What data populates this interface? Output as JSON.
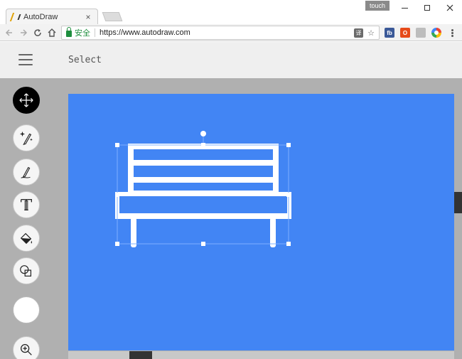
{
  "browser": {
    "tab_title": "AutoDraw",
    "tab_close": "×",
    "touch_label": "touch",
    "secure_label": "安全",
    "url": "https://www.autodraw.com",
    "translate_icon_text": "译",
    "star_icon": "☆",
    "extensions": [
      "fb",
      "O",
      "",
      ""
    ]
  },
  "app": {
    "mode_label": "Select",
    "canvas_color": "#4285f4",
    "drawing_color": "#ffffff",
    "selected_tool": "move",
    "tools": [
      "move",
      "autodraw",
      "draw",
      "type",
      "fill",
      "shape",
      "color",
      "zoom"
    ]
  }
}
